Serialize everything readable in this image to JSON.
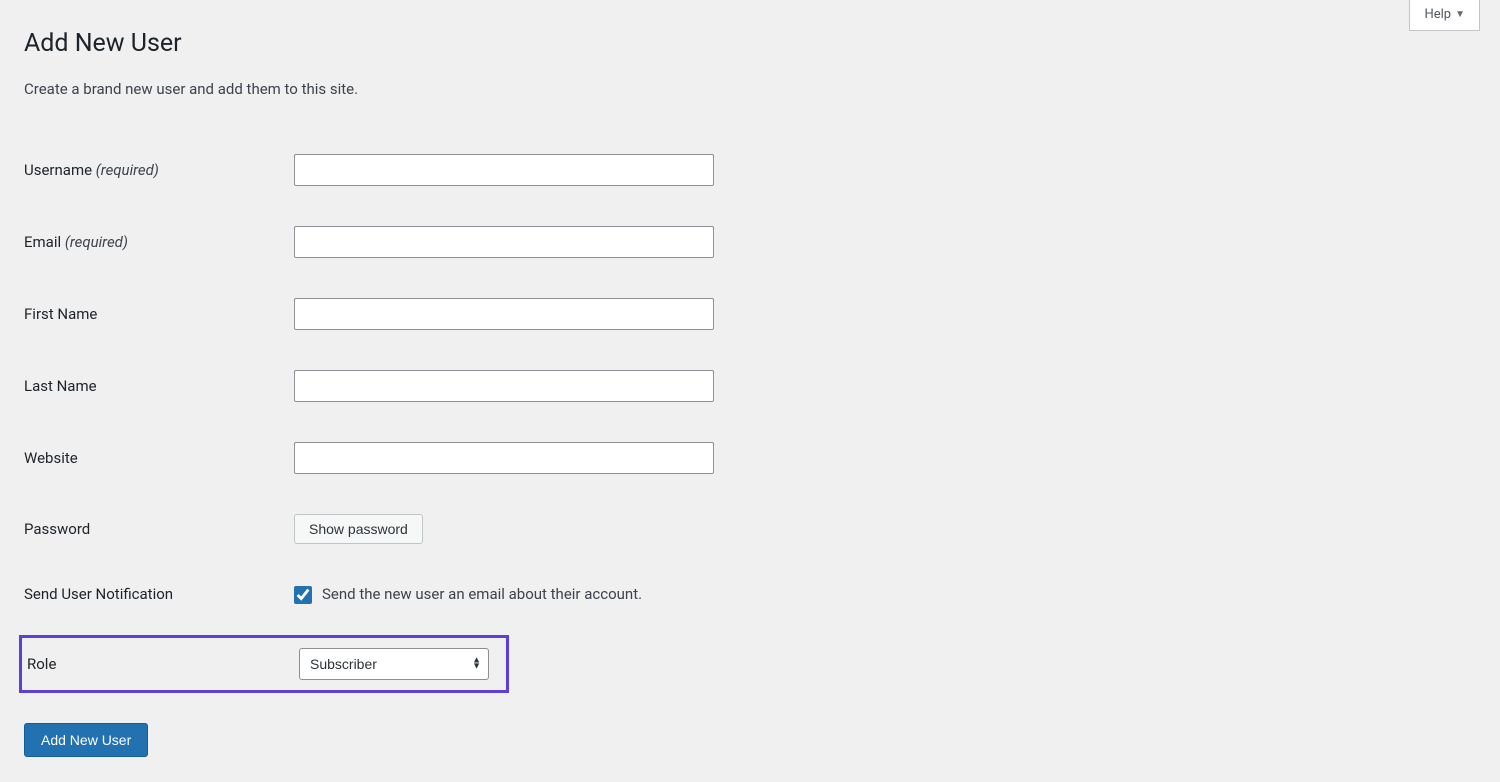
{
  "header": {
    "help_label": "Help"
  },
  "page": {
    "title": "Add New User",
    "description": "Create a brand new user and add them to this site."
  },
  "form": {
    "username": {
      "label": "Username",
      "required_text": "(required)",
      "value": ""
    },
    "email": {
      "label": "Email",
      "required_text": "(required)",
      "value": ""
    },
    "first_name": {
      "label": "First Name",
      "value": ""
    },
    "last_name": {
      "label": "Last Name",
      "value": ""
    },
    "website": {
      "label": "Website",
      "value": ""
    },
    "password": {
      "label": "Password",
      "button_label": "Show password"
    },
    "notification": {
      "label": "Send User Notification",
      "checkbox_text": "Send the new user an email about their account.",
      "checked": true
    },
    "role": {
      "label": "Role",
      "selected": "Subscriber"
    },
    "submit_label": "Add New User"
  }
}
